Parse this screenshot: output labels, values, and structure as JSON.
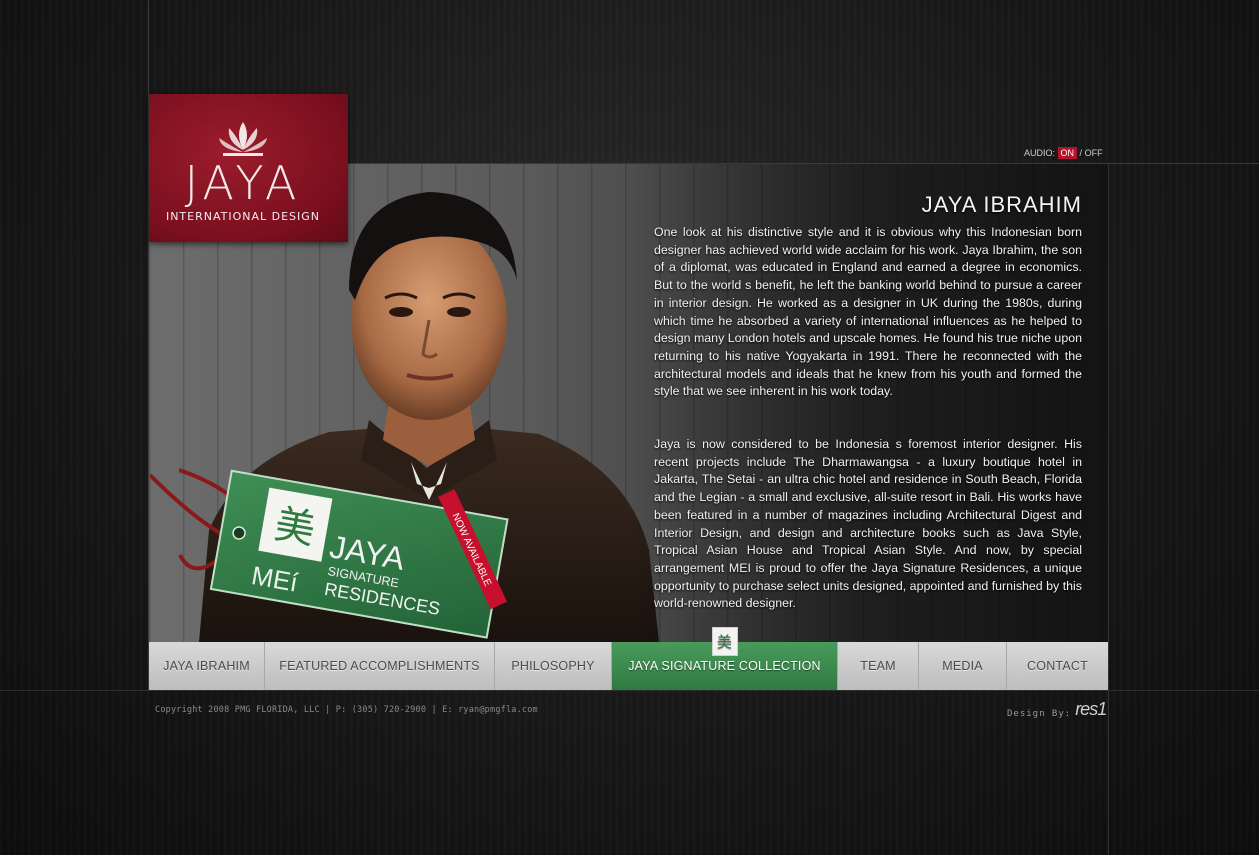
{
  "audio": {
    "label": "AUDIO:",
    "on": "ON",
    "sep": "/",
    "off": "OFF"
  },
  "logo": {
    "brand": "JAYA",
    "sub": "INTERNATIONAL DESIGN"
  },
  "bio": {
    "title": "JAYA IBRAHIM",
    "p1": "One look at his distinctive style and it is obvious why this Indonesian born designer has achieved world wide acclaim for his work. Jaya Ibrahim, the son of a diplomat, was educated in England and earned a degree in economics. But to the world s benefit, he left the banking world behind to pursue a career in interior design. He worked as a designer in UK during the 1980s, during which time he absorbed a variety of international influences as he helped to design many London hotels and upscale homes. He found his true niche upon returning to his native Yogyakarta in 1991. There he reconnected with the architectural models and ideals that he knew from his youth and formed the style that we see inherent in his work today.",
    "p2": "Jaya is now considered to be Indonesia s foremost interior designer. His recent projects include The Dharmawangsa - a luxury boutique hotel in Jakarta, The Setai - an ultra chic hotel and residence in South Beach, Florida and the Legian - a small and exclusive, all-suite resort in Bali. His works have been featured in a number of magazines including Architectural Digest and Interior Design, and design and architecture books such as Java Style, Tropical Asian House and Tropical Asian Style. And now, by special arrangement MEI is proud to offer the Jaya Signature Residences, a unique opportunity to purchase select units designed, appointed and furnished by this world-renowned designer."
  },
  "tag": {
    "glyph": "美",
    "mei": "MEí",
    "jaya": "JAYA",
    "signature": "SIGNATURE",
    "residences": "RESIDENCES",
    "ribbon": "NOW AVAILABLE"
  },
  "nav": {
    "items": [
      {
        "label": "JAYA IBRAHIM"
      },
      {
        "label": "FEATURED ACCOMPLISHMENTS"
      },
      {
        "label": "PHILOSOPHY"
      },
      {
        "label": "JAYA SIGNATURE COLLECTION",
        "badge": "美"
      },
      {
        "label": "TEAM"
      },
      {
        "label": "MEDIA"
      },
      {
        "label": "CONTACT"
      }
    ]
  },
  "footer": {
    "copyright": "Copyright 2008 PMG FLORIDA, LLC | P: (305) 720-2900 | E: ryan@pmgfla.com",
    "design_by": "Design By:",
    "designer": "res1"
  },
  "colors": {
    "brand_red": "#8b1424",
    "accent_green": "#2f7a42"
  }
}
